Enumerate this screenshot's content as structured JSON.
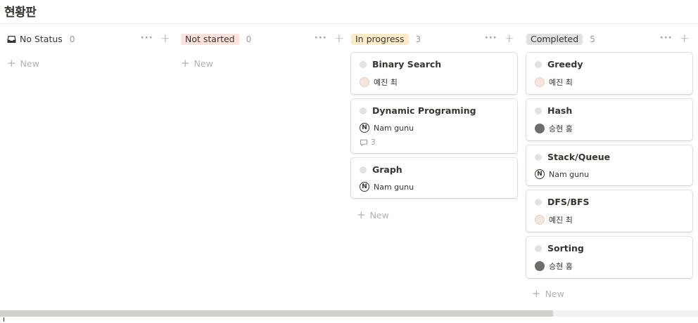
{
  "board": {
    "title": "현황판"
  },
  "new_label": "New",
  "colors": {
    "not_started_tag": "#ffe2dd",
    "in_progress_tag": "#fdecc8",
    "completed_tag": "#e3e2e0"
  },
  "columns": [
    {
      "label": "No Status",
      "count": "0",
      "icon": "inbox-icon",
      "cards": []
    },
    {
      "label": "Not started",
      "count": "0",
      "cards": []
    },
    {
      "label": "In progress",
      "count": "3",
      "cards": [
        {
          "title": "Binary Search",
          "person": "예진 최",
          "avatar": "light"
        },
        {
          "title": "Dynamic Programing",
          "person": "Nam gunu",
          "avatar": "notion",
          "comments": "3"
        },
        {
          "title": "Graph",
          "person": "Nam gunu",
          "avatar": "notion"
        }
      ]
    },
    {
      "label": "Completed",
      "count": "5",
      "cards": [
        {
          "title": "Greedy",
          "person": "예진 최",
          "avatar": "light"
        },
        {
          "title": "Hash",
          "person": "승현 홍",
          "avatar": "dark"
        },
        {
          "title": "Stack/Queue",
          "person": "Nam gunu",
          "avatar": "notion"
        },
        {
          "title": "DFS/BFS",
          "person": "예진 최",
          "avatar": "light"
        },
        {
          "title": "Sorting",
          "person": "승현 홍",
          "avatar": "dark"
        }
      ]
    }
  ],
  "avatar_letter": "N"
}
